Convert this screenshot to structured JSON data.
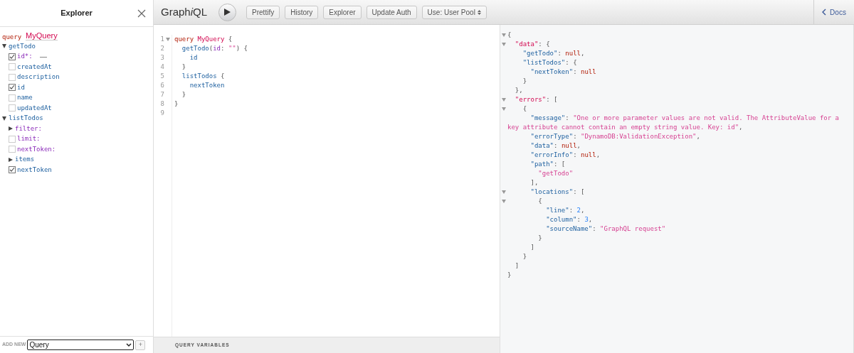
{
  "explorer": {
    "title": "Explorer",
    "operation": {
      "keyword": "query",
      "name": "MyQuery"
    },
    "tree": [
      {
        "kind": "object",
        "label": "getTodo",
        "expanded": true,
        "children": [
          {
            "kind": "arg",
            "label": "id*:",
            "checked": true,
            "has_input": true
          },
          {
            "kind": "field",
            "label": "createdAt",
            "checked": false
          },
          {
            "kind": "field",
            "label": "description",
            "checked": false
          },
          {
            "kind": "field",
            "label": "id",
            "checked": true
          },
          {
            "kind": "field",
            "label": "name",
            "checked": false
          },
          {
            "kind": "field",
            "label": "updatedAt",
            "checked": false
          }
        ]
      },
      {
        "kind": "object",
        "label": "listTodos",
        "expanded": true,
        "children": [
          {
            "kind": "argobject",
            "label": "filter:",
            "expanded": false
          },
          {
            "kind": "arg",
            "label": "limit:",
            "checked": false
          },
          {
            "kind": "arg",
            "label": "nextToken:",
            "checked": false
          },
          {
            "kind": "subobject",
            "label": "items",
            "expanded": false
          },
          {
            "kind": "field",
            "label": "nextToken",
            "checked": true
          }
        ]
      }
    ],
    "add_new": {
      "label": "ADD NEW",
      "value": "Query",
      "plus": "+"
    }
  },
  "toolbar": {
    "title_parts": [
      "Graph",
      "i",
      "QL"
    ],
    "buttons": [
      "Prettify",
      "History",
      "Explorer",
      "Update Auth"
    ],
    "select": "Use: User Pool",
    "docs": "Docs"
  },
  "editor": {
    "lines": [
      {
        "num": "1",
        "foldable": true,
        "tokens": [
          {
            "t": "query ",
            "kind": "keyword"
          },
          {
            "t": "MyQuery",
            "kind": "def"
          },
          {
            "t": " {",
            "kind": "punct"
          }
        ]
      },
      {
        "num": "2",
        "foldable": false,
        "tokens": [
          {
            "t": "  getTodo",
            "kind": "property"
          },
          {
            "t": "(",
            "kind": "punct"
          },
          {
            "t": "id",
            "kind": "attribute"
          },
          {
            "t": ": ",
            "kind": "punct"
          },
          {
            "t": "\"\"",
            "kind": "string"
          },
          {
            "t": ") {",
            "kind": "punct"
          }
        ]
      },
      {
        "num": "3",
        "foldable": false,
        "tokens": [
          {
            "t": "    id",
            "kind": "property"
          }
        ]
      },
      {
        "num": "4",
        "foldable": false,
        "tokens": [
          {
            "t": "  }",
            "kind": "punct"
          }
        ]
      },
      {
        "num": "5",
        "foldable": false,
        "tokens": [
          {
            "t": "  listTodos",
            "kind": "property"
          },
          {
            "t": " {",
            "kind": "punct"
          }
        ]
      },
      {
        "num": "6",
        "foldable": false,
        "tokens": [
          {
            "t": "    nextToken",
            "kind": "property"
          }
        ]
      },
      {
        "num": "7",
        "foldable": false,
        "tokens": [
          {
            "t": "  }",
            "kind": "punct"
          }
        ]
      },
      {
        "num": "8",
        "foldable": false,
        "tokens": [
          {
            "t": "}",
            "kind": "punct"
          }
        ]
      },
      {
        "num": "9",
        "foldable": false
      }
    ],
    "variables_title": "QUERY VARIABLES"
  },
  "result": {
    "lines": [
      {
        "foldable": true,
        "tokens": [
          {
            "t": "{",
            "kind": "punct"
          }
        ]
      },
      {
        "foldable": true,
        "tokens": [
          {
            "t": "  \"data\"",
            "kind": "def"
          },
          {
            "t": ": {",
            "kind": "punct"
          }
        ]
      },
      {
        "foldable": false,
        "tokens": [
          {
            "t": "    \"getTodo\"",
            "kind": "property"
          },
          {
            "t": ": ",
            "kind": "punct"
          },
          {
            "t": "null",
            "kind": "keyword"
          },
          {
            "t": ",",
            "kind": "punct"
          }
        ]
      },
      {
        "foldable": false,
        "tokens": [
          {
            "t": "    \"listTodos\"",
            "kind": "property"
          },
          {
            "t": ": {",
            "kind": "punct"
          }
        ]
      },
      {
        "foldable": false,
        "tokens": [
          {
            "t": "      \"nextToken\"",
            "kind": "property"
          },
          {
            "t": ": ",
            "kind": "punct"
          },
          {
            "t": "null",
            "kind": "keyword"
          }
        ]
      },
      {
        "foldable": false,
        "tokens": [
          {
            "t": "    }",
            "kind": "punct"
          }
        ]
      },
      {
        "foldable": false,
        "tokens": [
          {
            "t": "  },",
            "kind": "punct"
          }
        ]
      },
      {
        "foldable": true,
        "tokens": [
          {
            "t": "  \"errors\"",
            "kind": "def"
          },
          {
            "t": ": [",
            "kind": "punct"
          }
        ]
      },
      {
        "foldable": true,
        "tokens": [
          {
            "t": "    {",
            "kind": "punct"
          }
        ]
      },
      {
        "foldable": false,
        "tokens": [
          {
            "t": "      \"message\"",
            "kind": "property"
          },
          {
            "t": ": ",
            "kind": "punct"
          },
          {
            "t": "\"One or more parameter values are not valid. The AttributeValue for a key attribute cannot contain an empty string value. Key: id\"",
            "kind": "string"
          },
          {
            "t": ",",
            "kind": "punct"
          }
        ]
      },
      {
        "foldable": false,
        "tokens": [
          {
            "t": "      \"errorType\"",
            "kind": "property"
          },
          {
            "t": ": ",
            "kind": "punct"
          },
          {
            "t": "\"DynamoDB:ValidationException\"",
            "kind": "string"
          },
          {
            "t": ",",
            "kind": "punct"
          }
        ]
      },
      {
        "foldable": false,
        "tokens": [
          {
            "t": "      \"data\"",
            "kind": "property"
          },
          {
            "t": ": ",
            "kind": "punct"
          },
          {
            "t": "null",
            "kind": "keyword"
          },
          {
            "t": ",",
            "kind": "punct"
          }
        ]
      },
      {
        "foldable": false,
        "tokens": [
          {
            "t": "      \"errorInfo\"",
            "kind": "property"
          },
          {
            "t": ": ",
            "kind": "punct"
          },
          {
            "t": "null",
            "kind": "keyword"
          },
          {
            "t": ",",
            "kind": "punct"
          }
        ]
      },
      {
        "foldable": false,
        "tokens": [
          {
            "t": "      \"path\"",
            "kind": "property"
          },
          {
            "t": ": [",
            "kind": "punct"
          }
        ]
      },
      {
        "foldable": false,
        "tokens": [
          {
            "t": "        \"getTodo\"",
            "kind": "string"
          }
        ]
      },
      {
        "foldable": false,
        "tokens": [
          {
            "t": "      ],",
            "kind": "punct"
          }
        ]
      },
      {
        "foldable": true,
        "tokens": [
          {
            "t": "      \"locations\"",
            "kind": "property"
          },
          {
            "t": ": [",
            "kind": "punct"
          }
        ]
      },
      {
        "foldable": true,
        "tokens": [
          {
            "t": "        {",
            "kind": "punct"
          }
        ]
      },
      {
        "foldable": false,
        "tokens": [
          {
            "t": "          \"line\"",
            "kind": "property"
          },
          {
            "t": ": ",
            "kind": "punct"
          },
          {
            "t": "2",
            "kind": "number"
          },
          {
            "t": ",",
            "kind": "punct"
          }
        ]
      },
      {
        "foldable": false,
        "tokens": [
          {
            "t": "          \"column\"",
            "kind": "property"
          },
          {
            "t": ": ",
            "kind": "punct"
          },
          {
            "t": "3",
            "kind": "number"
          },
          {
            "t": ",",
            "kind": "punct"
          }
        ]
      },
      {
        "foldable": false,
        "tokens": [
          {
            "t": "          \"sourceName\"",
            "kind": "property"
          },
          {
            "t": ": ",
            "kind": "punct"
          },
          {
            "t": "\"GraphQL request\"",
            "kind": "string"
          }
        ]
      },
      {
        "foldable": false,
        "tokens": [
          {
            "t": "        }",
            "kind": "punct"
          }
        ]
      },
      {
        "foldable": false,
        "tokens": [
          {
            "t": "      ]",
            "kind": "punct"
          }
        ]
      },
      {
        "foldable": false,
        "tokens": [
          {
            "t": "    }",
            "kind": "punct"
          }
        ]
      },
      {
        "foldable": false,
        "tokens": [
          {
            "t": "  ]",
            "kind": "punct"
          }
        ]
      },
      {
        "foldable": false,
        "tokens": [
          {
            "t": "}",
            "kind": "punct"
          }
        ]
      }
    ]
  }
}
